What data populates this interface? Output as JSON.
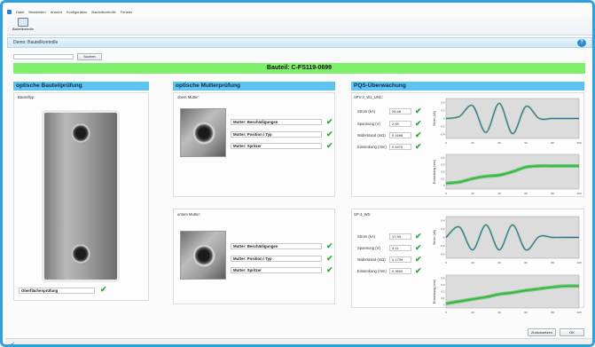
{
  "menu": [
    "Datei",
    "Bearbeiten",
    "Ansicht",
    "Konfiguration",
    "Bauteilkontrolle",
    "Fenster"
  ],
  "toolbar": {
    "button_label": "Bauteilkontrolle"
  },
  "window": {
    "title": "Demo: Bauteilkontrolle"
  },
  "search": {
    "value": "",
    "button_label": "Suchen"
  },
  "part": {
    "label": "Bauteil: C-FS119-0699"
  },
  "left": {
    "header": "optische Bauteilprüfung",
    "sub_label": "Bauteiltyp:",
    "surface_field": "Oberflächenprüfung"
  },
  "middle": {
    "header": "optische Mutterprüfung",
    "upper_label": "obere Mutter:",
    "lower_label": "untere Mutter:",
    "checks": [
      "Mutter: Beschädigungen",
      "Mutter: Position / Typ",
      "Mutter: Spritzer"
    ]
  },
  "right": {
    "header": "PQS-Überwachung",
    "welds": [
      {
        "name": "SPV-3_W1_UNC:",
        "rows": [
          {
            "label": "Strom (kA)",
            "value": "26.48"
          },
          {
            "label": "Spannung (V)",
            "value": "2.93"
          },
          {
            "label": "Widerstand (mΩ)",
            "value": "0.1698"
          },
          {
            "label": "Einsenkung (mm)",
            "value": "0.4470"
          }
        ]
      },
      {
        "name": "SP-3_W5:",
        "rows": [
          {
            "label": "Strom (kA)",
            "value": "17.93"
          },
          {
            "label": "Spannung (V)",
            "value": "3.11"
          },
          {
            "label": "Widerstand (mΩ)",
            "value": "0.1739"
          },
          {
            "label": "Einsenkung (mm)",
            "value": "0.3600"
          }
        ]
      }
    ]
  },
  "chart_data": [
    {
      "type": "line",
      "x": [
        0,
        10,
        20,
        30,
        40,
        50,
        60,
        70,
        80,
        90,
        100
      ],
      "xlim": [
        0,
        100
      ],
      "ylim": [
        -0.5,
        0.5
      ],
      "series": [
        {
          "values": [
            0,
            0.05,
            0.32,
            -0.35,
            0.38,
            -0.38,
            0.3,
            0,
            0,
            0,
            0
          ]
        }
      ],
      "xticks": [
        "0",
        "20",
        "40",
        "60",
        "80",
        "100"
      ],
      "yticks": [
        "0.4",
        "0.2",
        "0",
        "-0.2",
        "-0.4"
      ],
      "ylabel": "Strom (kA)",
      "line_color": "#3b5cb8",
      "highlight_color": "#1fb32e"
    },
    {
      "type": "area",
      "x": [
        0,
        10,
        20,
        30,
        40,
        50,
        60,
        70,
        80,
        90,
        100
      ],
      "xlim": [
        0,
        100
      ],
      "ylim": [
        0,
        0.6
      ],
      "series": [
        {
          "values": [
            0.1,
            0.12,
            0.18,
            0.22,
            0.24,
            0.3,
            0.38,
            0.4,
            0.4,
            0.4,
            0.4
          ]
        }
      ],
      "xticks": [
        "0",
        "20",
        "40",
        "60",
        "80",
        "100"
      ],
      "yticks": [
        "0.4",
        "0.3",
        "0.2",
        "0.1",
        "0"
      ],
      "ylabel": "Einsenkung (mm)",
      "line_color": "#1fb32e"
    },
    {
      "type": "line",
      "x": [
        0,
        10,
        20,
        30,
        40,
        50,
        60,
        70,
        80,
        90,
        100
      ],
      "xlim": [
        0,
        100
      ],
      "ylim": [
        -0.5,
        0.5
      ],
      "series": [
        {
          "values": [
            0,
            0.25,
            -0.3,
            0.3,
            -0.3,
            0.3,
            -0.3,
            0.02,
            0,
            0,
            0
          ]
        }
      ],
      "xticks": [
        "0",
        "20",
        "40",
        "60",
        "80",
        "100"
      ],
      "yticks": [
        "0.4",
        "0.2",
        "0",
        "-0.2",
        "-0.4"
      ],
      "ylabel": "Strom (kA)",
      "line_color": "#3b5cb8",
      "highlight_color": "#1fb32e"
    },
    {
      "type": "area",
      "x": [
        0,
        10,
        20,
        30,
        40,
        50,
        60,
        70,
        80,
        90,
        100
      ],
      "xlim": [
        0,
        100
      ],
      "ylim": [
        0,
        0.6
      ],
      "series": [
        {
          "values": [
            0.08,
            0.12,
            0.16,
            0.2,
            0.25,
            0.28,
            0.32,
            0.35,
            0.38,
            0.4,
            0.4
          ]
        }
      ],
      "xticks": [
        "0",
        "20",
        "40",
        "60",
        "80",
        "100"
      ],
      "yticks": [
        "0.4",
        "0.3",
        "0.2",
        "0.1",
        "0"
      ],
      "ylabel": "Einsenkung (mm)",
      "line_color": "#1fb32e"
    }
  ],
  "footer": {
    "back_label": "Zurücksetzen",
    "ok_label": "OK"
  },
  "colors": {
    "accent": "#2fa2dc",
    "section": "#5fc3f0",
    "ok_green": "#2fa83a",
    "part_bar": "#7ef06a"
  }
}
